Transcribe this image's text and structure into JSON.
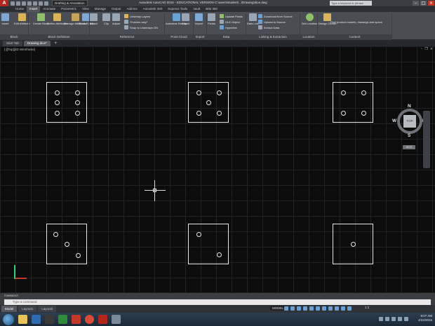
{
  "window": {
    "app_logo": "A",
    "workspace": "Drafting & Annotation",
    "title": "Autodesk AutoCAD 2015 - EDUCATIONAL VERSION    C:\\users\\student\\...\\Drawing\\dice.dwg",
    "search_placeholder": "Type a keyword or phrase"
  },
  "ribbon_tabs": [
    "Home",
    "Insert",
    "Annotate",
    "Parametric",
    "View",
    "Manage",
    "Output",
    "Add-ins",
    "Autodesk 360",
    "Express Tools",
    "Vault",
    "BIM 360"
  ],
  "active_ribbon_tab": "Insert",
  "ribbon": {
    "buttons": [
      {
        "label": "Insert"
      },
      {
        "label": "Edit Attribute"
      },
      {
        "label": "Create Block"
      },
      {
        "label": "Define Attributes"
      },
      {
        "label": "Manage Attributes"
      },
      {
        "label": "Block Editor"
      },
      {
        "label": "Attach"
      },
      {
        "label": "Clip"
      },
      {
        "label": "Adjust"
      },
      {
        "label": "Autodesk ReCap"
      },
      {
        "label": "Attach"
      },
      {
        "label": "Import"
      },
      {
        "label": "Fields"
      },
      {
        "label": "Data Link"
      },
      {
        "label": "Set Location"
      },
      {
        "label": "Design Center"
      }
    ],
    "small_items": [
      "Underlay Layers",
      "*Frames vary*",
      "Snap to Underlays ON",
      "Update Fields",
      "OLE Object",
      "Hyperlink",
      "Download from Source",
      "Upload to Source",
      "Extract Data",
      "Find product models, drawings and specs"
    ],
    "panels": [
      "Block",
      "Block Definition",
      "Reference",
      "Point Cloud",
      "Import",
      "Data",
      "Linking & Extraction",
      "Location",
      "Content"
    ]
  },
  "doc_tabs": [
    "Start Tab",
    "Drawing dice*"
  ],
  "active_doc_tab": "Drawing dice*",
  "viewport": {
    "label": "[-][Top][2D Wireframe]"
  },
  "viewcube": {
    "north": "N",
    "south": "S",
    "east": "E",
    "west": "W",
    "face": "TOP",
    "wcs": "WCS"
  },
  "dice": [
    {
      "face_value": 6
    },
    {
      "face_value": 5
    },
    {
      "face_value": 4
    },
    {
      "face_value": 3
    },
    {
      "face_value": 2
    },
    {
      "face_value": 1
    }
  ],
  "command": {
    "history": "Command:",
    "placeholder": "Type a command"
  },
  "layout_tabs": [
    "Model",
    "Layout1",
    "Layout2"
  ],
  "active_layout_tab": "Model",
  "status": {
    "model": "MODEL",
    "scale": "1:1"
  },
  "taskbar": {
    "time": "8:07 AM",
    "date": "4/22/2015"
  },
  "colors": {
    "title_bar": "#3a3d42",
    "ribbon": "#4a4e54",
    "drawing_bg": "#0c0c0c",
    "grid": "#1f2326",
    "ucs_x": "#c0392b",
    "ucs_y": "#2ecc71"
  }
}
